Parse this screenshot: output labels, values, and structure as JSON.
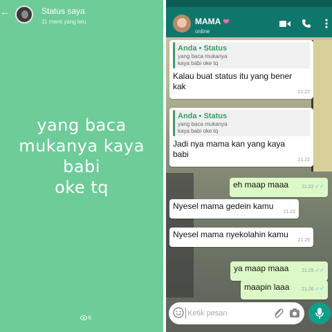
{
  "status_view": {
    "back_icon": "arrow-left-icon",
    "title": "Status saya",
    "time": "11 menit yang lalu",
    "text_lines": [
      "yang baca",
      "mukanya kaya",
      "babi",
      "oke tq"
    ],
    "views": "6",
    "background_color": "#6dcc98"
  },
  "chat": {
    "contact_name": "MAMA",
    "contact_emoji": "heart-icon",
    "contact_status": "online",
    "header_color": "#0e766a",
    "messages": [
      {
        "direction": "in",
        "quote_author": "Anda • Status",
        "quote_text": "yang baca mukanya kaya babi oke tq",
        "text": "Kalau buat status itu yang bener kak",
        "time": "21.22"
      },
      {
        "direction": "in",
        "quote_author": "Anda • Status",
        "quote_text": "yang baca mukanya kaya babi oke tq",
        "text": "Jadi nya mama kan yang kaya babi",
        "time": "21.22"
      },
      {
        "direction": "out",
        "text": "eh maap maaa",
        "time": "21.22"
      },
      {
        "direction": "in",
        "text": "Nyesel mama gedein kamu",
        "time": "21.22"
      },
      {
        "direction": "in",
        "text": "Nyesel mama nyekolahin kamu",
        "time": "21.25"
      },
      {
        "direction": "out",
        "text": "ya maap maaa",
        "time": "21.25"
      },
      {
        "direction": "out",
        "text": "maapin laaa",
        "time": "21.26"
      }
    ],
    "input_placeholder": "Ketik pesan",
    "icons": [
      "video-call-icon",
      "phone-icon",
      "menu-icon",
      "emoji-icon",
      "attach-icon",
      "camera-icon",
      "mic-icon"
    ]
  }
}
